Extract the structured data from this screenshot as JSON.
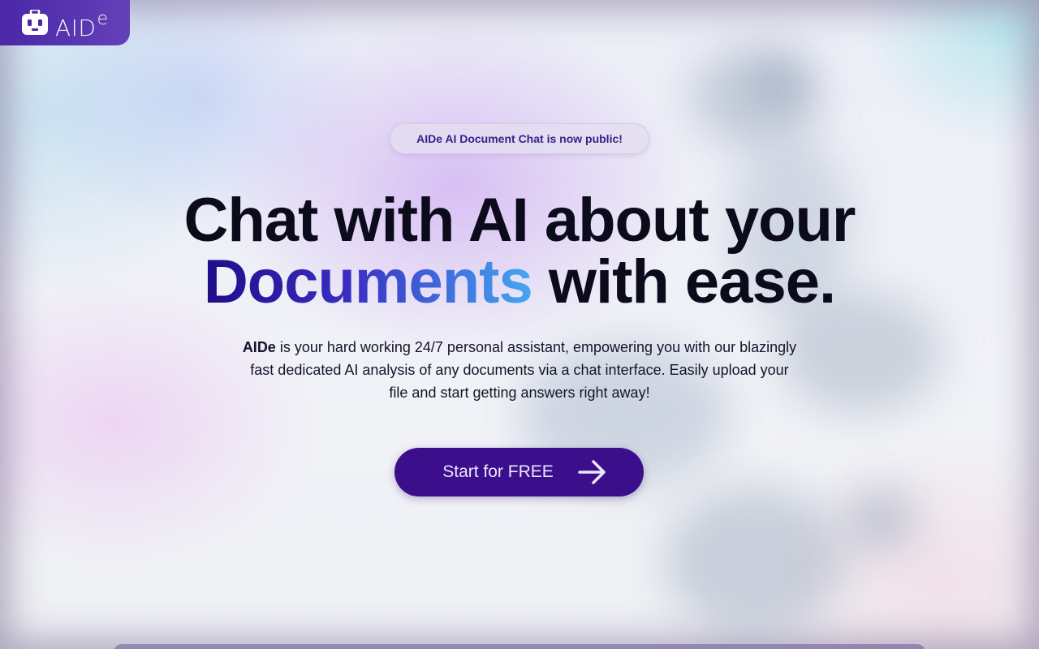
{
  "logo": {
    "text": "AID",
    "superscript": "e",
    "icon": "robot-icon"
  },
  "announcement": {
    "text": "AIDe AI Document Chat is now public!"
  },
  "hero": {
    "title_line1": "Chat with AI about your",
    "title_highlight": "Documents",
    "title_line2_rest": " with ease.",
    "description_brand": "AIDe",
    "description_line1": " is your hard working 24/7 personal assistant, empowering you with our blazingly",
    "description_line2": "fast dedicated AI analysis of any documents via a chat interface. Easily upload your",
    "description_line3": "file and start getting answers right away!"
  },
  "cta": {
    "label": "Start for FREE",
    "icon": "arrow-right-icon"
  },
  "colors": {
    "brand": "#4a28a6",
    "button": "#3b0f8c",
    "gradient_start": "#1f0c88",
    "gradient_end": "#44a8f2",
    "text": "#0b0b1c"
  }
}
